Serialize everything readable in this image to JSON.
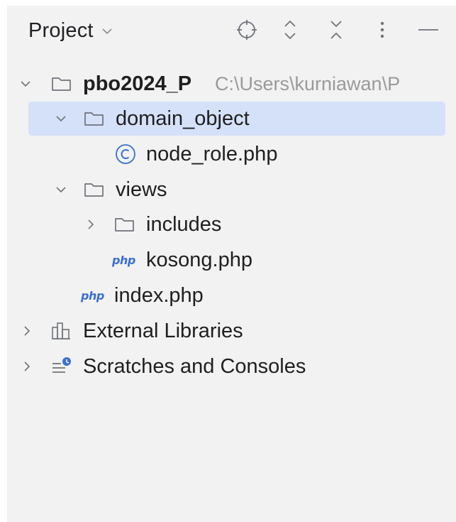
{
  "header": {
    "title": "Project",
    "title_icon": "chevron-down-icon",
    "tools": [
      "locate-icon",
      "expand-all-icon",
      "collapse-all-icon",
      "more-icon",
      "minimize-icon"
    ]
  },
  "tree": {
    "root": {
      "label": "pbo2024_P",
      "path": "C:\\Users\\kurniawan\\P",
      "icon": "folder-icon",
      "expanded": true
    },
    "domain_object": {
      "label": "domain_object",
      "icon": "folder-icon",
      "expanded": true,
      "selected": true
    },
    "node_role": {
      "label": "node_role.php",
      "icon": "php-class-icon"
    },
    "views": {
      "label": "views",
      "icon": "folder-icon",
      "expanded": true
    },
    "includes": {
      "label": "includes",
      "icon": "folder-icon",
      "expanded": false
    },
    "kosong": {
      "label": "kosong.php",
      "icon": "php-file-icon",
      "badge": "php"
    },
    "index": {
      "label": "index.php",
      "icon": "php-file-icon",
      "badge": "php"
    },
    "external_libraries": {
      "label": "External Libraries",
      "icon": "library-icon",
      "expanded": false
    },
    "scratches": {
      "label": "Scratches and Consoles",
      "icon": "scratches-icon",
      "expanded": false
    }
  },
  "colors": {
    "background": "#f2f2f2",
    "selection": "#d5e1f9",
    "text": "#1f1f1f",
    "muted": "#9a9a9a",
    "icon": "#6f737a",
    "php_blue": "#3b6fd4"
  }
}
